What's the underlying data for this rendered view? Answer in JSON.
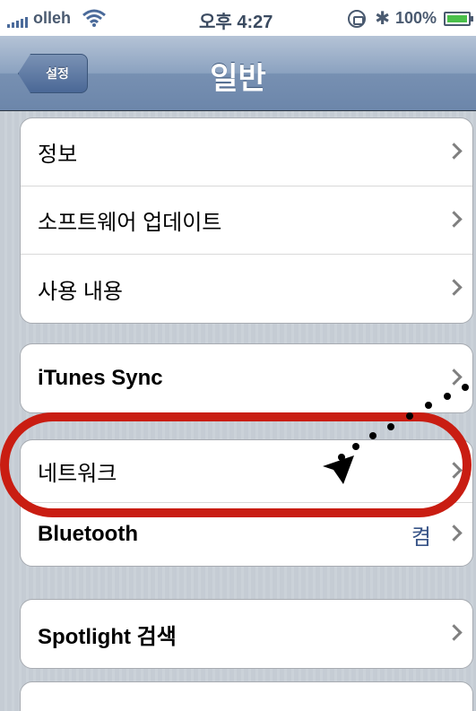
{
  "status_bar": {
    "carrier": "olleh",
    "time": "오후 4:27",
    "battery_percent": "100%"
  },
  "nav": {
    "back_label": "설정",
    "title": "일반"
  },
  "groups": [
    {
      "rows": [
        {
          "label": "정보",
          "value": ""
        },
        {
          "label": "소프트웨어 업데이트",
          "value": ""
        },
        {
          "label": "사용 내용",
          "value": ""
        }
      ]
    },
    {
      "rows": [
        {
          "label": "iTunes Sync",
          "value": ""
        }
      ]
    },
    {
      "rows": [
        {
          "label": "네트워크",
          "value": ""
        },
        {
          "label": "Bluetooth",
          "value": "켬"
        }
      ]
    },
    {
      "rows": [
        {
          "label": "Spotlight 검색",
          "value": ""
        }
      ]
    }
  ],
  "colors": {
    "annotation": "#c91d12",
    "nav_bar": "#7790b2",
    "value_text": "#385487"
  },
  "icons": [
    "signal-bars-icon",
    "wifi-icon",
    "rotation-lock-icon",
    "bluetooth-icon",
    "battery-icon",
    "chevron-right-icon"
  ]
}
